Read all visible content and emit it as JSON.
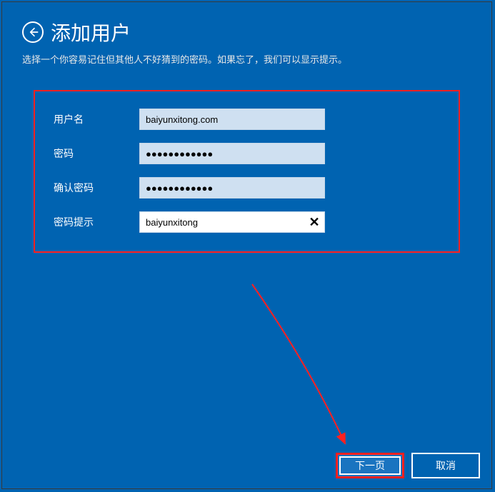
{
  "header": {
    "title": "添加用户",
    "subtitle": "选择一个你容易记住但其他人不好猜到的密码。如果忘了，我们可以显示提示。"
  },
  "form": {
    "username": {
      "label": "用户名",
      "value": "baiyunxitong.com"
    },
    "password": {
      "label": "密码",
      "value": "●●●●●●●●●●●●"
    },
    "confirm": {
      "label": "确认密码",
      "value": "●●●●●●●●●●●●"
    },
    "hint": {
      "label": "密码提示",
      "value": "baiyunxitong"
    }
  },
  "buttons": {
    "next": "下一页",
    "cancel": "取消"
  },
  "icons": {
    "clear": "✕"
  },
  "colors": {
    "background": "#0063B1",
    "highlight_border": "#ff2020",
    "input_bg": "#cfe0f1",
    "input_active_bg": "#ffffff"
  }
}
